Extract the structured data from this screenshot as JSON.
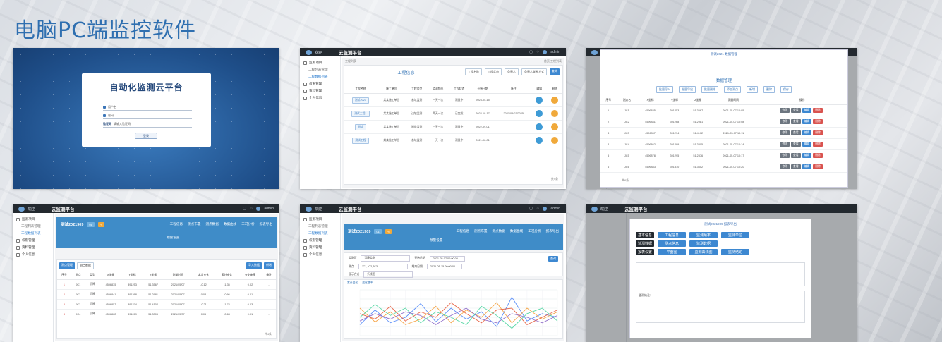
{
  "page": {
    "title": "电脑PC端监控软件"
  },
  "login": {
    "app_title": "自动化监测云平台",
    "username_placeholder": "用户名",
    "password_placeholder": "密码",
    "captcha_label": "验证码",
    "captcha_hint": "请输入验证码",
    "submit_label": "登录"
  },
  "app": {
    "welcome": "欢迎",
    "platform_title": "云监测平台",
    "user": "admin",
    "sidebar": [
      "监测项目",
      "工程列表管理",
      "工程数据列表",
      "权限管理",
      "资料管理",
      "个人信息"
    ]
  },
  "shot2": {
    "crumb_left": "工程列表",
    "crumb_right": "首页/工程列表",
    "heading": "工程信息",
    "filters": [
      "工程名称",
      "工程状态",
      "负责人",
      "负责人联系方式",
      "查询"
    ],
    "columns": [
      "工程名称",
      "施工单位",
      "工程类型",
      "监测频率",
      "工程状态",
      "开始日期",
      "备注",
      "编辑",
      "删除"
    ],
    "rows": [
      [
        "测试2021",
        "某某施工单位",
        "基坑监测",
        "一天一次",
        "测量中",
        "2023-05-15",
        "",
        "",
        ""
      ],
      [
        "测试工程1",
        "某某施工单位",
        "边坡监测",
        "两天一次",
        "已完成",
        "2022-10-17",
        "2021/05/07/2025",
        "",
        ""
      ],
      [
        "测试",
        "某某施工单位",
        "隧道监测",
        "三天一次",
        "测量中",
        "2022-09-01",
        "",
        "",
        ""
      ],
      [
        "测试工程",
        "某某施工单位",
        "基坑监测",
        "一天一次",
        "测量中",
        "2021-06-01",
        "",
        "",
        ""
      ]
    ],
    "pager": "共4条"
  },
  "shot3": {
    "dialog_title": "测试2021 数据管理",
    "section": "数据管理",
    "actions": [
      "批量导入",
      "批量导出",
      "批量删除",
      "添加测点",
      "新增",
      "删除",
      "保存"
    ],
    "columns": [
      "序号",
      "测点名",
      "X坐标",
      "Y坐标",
      "Z坐标",
      "测量时间",
      "操作"
    ],
    "rows": [
      [
        "1",
        "JC1",
        "4596835",
        "391253",
        "51.3567",
        "2021-05-07 10:05"
      ],
      [
        "2",
        "JC2",
        "4596841",
        "391268",
        "51.2981",
        "2021-05-07 10:08"
      ],
      [
        "3",
        "JC3",
        "4596857",
        "391274",
        "51.4102",
        "2021-05-07 10:11"
      ],
      [
        "4",
        "JC4",
        "4596862",
        "391289",
        "51.3305",
        "2021-05-07 10:14"
      ],
      [
        "5",
        "JC5",
        "4596878",
        "391295",
        "51.2876",
        "2021-05-07 10:17"
      ],
      [
        "6",
        "JC6",
        "4596883",
        "391310",
        "51.3652",
        "2021-05-07 10:20"
      ]
    ],
    "btn_labels": [
      "修改",
      "查看",
      "编辑",
      "删除"
    ],
    "pager": "共6条"
  },
  "shot4": {
    "project": "测试2021909",
    "badge": "01",
    "tabs": [
      "工程信息",
      "测点布置",
      "测点数据",
      "数据曲线",
      "工况分析",
      "报表导出"
    ],
    "subtab": "预警设置",
    "table_tabs": [
      "测点管理",
      "测点数据"
    ],
    "buttons": [
      "导入数据",
      "新增"
    ],
    "columns": [
      "序号",
      "测点",
      "类型",
      "X坐标",
      "Y坐标",
      "Z坐标",
      "测量时间",
      "本次变化",
      "累计变化",
      "变化速率",
      "备注"
    ],
    "rows": [
      [
        "1",
        "JC1",
        "沉降",
        "4596835",
        "391253",
        "51.3567",
        "2021/05/07",
        "-0.12",
        "-1.35",
        "0.02",
        "-"
      ],
      [
        "2",
        "JC2",
        "沉降",
        "4596841",
        "391268",
        "51.2981",
        "2021/05/07",
        "0.08",
        "-0.96",
        "0.01",
        "-"
      ],
      [
        "3",
        "JC3",
        "沉降",
        "4596857",
        "391274",
        "51.4102",
        "2021/05/07",
        "-0.21",
        "-1.74",
        "0.03",
        "-"
      ],
      [
        "4",
        "JC4",
        "沉降",
        "4596862",
        "391289",
        "51.3305",
        "2021/05/07",
        "0.05",
        "-0.63",
        "0.01",
        "-"
      ]
    ],
    "pager": "共4条"
  },
  "shot5": {
    "project": "测试2021909",
    "badge": "01",
    "tabs": [
      "工程信息",
      "测点布置",
      "测点数据",
      "数据曲线",
      "工况分析",
      "报表导出"
    ],
    "subtab": "预警设置",
    "form_labels": [
      "监测项",
      "测点",
      "开始日期",
      "结束日期",
      "显示方式"
    ],
    "form_values": [
      "沉降监测",
      "JC1,JC2,JC3",
      "2021-05-07 00:00:00",
      "2021-05-15 00:00:00",
      "折线图"
    ],
    "query_label": "查询",
    "chart_tabs": [
      "累计变化",
      "变化速率"
    ]
  },
  "shot6": {
    "dialog_title": "测试2021909 报表导出",
    "row_labels": [
      "基本信息",
      "监测数据",
      "报表设置"
    ],
    "actions": [
      [
        "工程信息",
        "监测频率",
        "监测单位"
      ],
      [
        "测点信息",
        "监测数据"
      ],
      [
        "平面图",
        "监测曲线图",
        "监测结论"
      ]
    ],
    "remark_label": "监测结论："
  },
  "chart_data": {
    "type": "line",
    "x": [
      1,
      2,
      3,
      4,
      5,
      6,
      7,
      8,
      9,
      10,
      11,
      12,
      13,
      14
    ],
    "series": [
      {
        "values": [
          12,
          28,
          14,
          20,
          35,
          15,
          30,
          18,
          26,
          10,
          42,
          16,
          24,
          20
        ],
        "color": "#5b8ff9"
      },
      {
        "values": [
          30,
          15,
          26,
          12,
          18,
          32,
          14,
          28,
          20,
          36,
          14,
          30,
          18,
          26
        ],
        "color": "#f6a74a"
      },
      {
        "values": [
          20,
          34,
          22,
          30,
          14,
          26,
          20,
          12,
          32,
          22,
          8,
          24,
          30,
          16
        ],
        "color": "#5ad8a6"
      },
      {
        "values": [
          24,
          18,
          32,
          16,
          26,
          20,
          36,
          24,
          14,
          28,
          30,
          12,
          20,
          28
        ],
        "color": "#e8684a"
      },
      {
        "values": [
          16,
          24,
          18,
          26,
          22,
          12,
          22,
          30,
          18,
          14,
          24,
          20,
          14,
          22
        ],
        "color": "#9270ca"
      }
    ],
    "ylim": [
      0,
      50
    ]
  }
}
